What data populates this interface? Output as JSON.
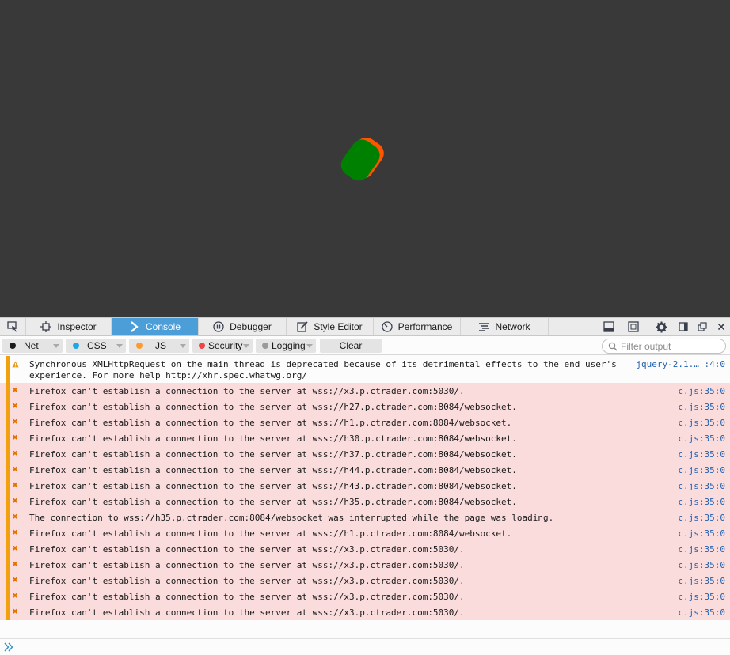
{
  "colors": {
    "page_bg": "#393939",
    "loader_front": "#008000",
    "loader_back": "#ff5500",
    "selected_tab": "#4c9ed9",
    "error_bg": "#fadcdc",
    "severity_bar": "#f1a10d",
    "location_link": "#1f60b0"
  },
  "toolbar": {
    "picker_icon": "element-picker-icon",
    "tabs": [
      {
        "label": "Inspector",
        "icon": "inspector-icon"
      },
      {
        "label": "Console",
        "icon": "console-icon"
      },
      {
        "label": "Debugger",
        "icon": "debugger-icon"
      },
      {
        "label": "Style Editor",
        "icon": "style-editor-icon"
      },
      {
        "label": "Performance",
        "icon": "performance-icon"
      },
      {
        "label": "Network",
        "icon": "network-icon"
      }
    ],
    "right_icons": [
      "split-console-icon",
      "responsive-mode-icon",
      "settings-icon",
      "dock-side-icon",
      "separate-window-icon",
      "close-icon"
    ]
  },
  "filters": {
    "buttons": [
      {
        "label": "Net",
        "dot_color": "#1a1a1a"
      },
      {
        "label": "CSS",
        "dot_color": "#1ea6e6"
      },
      {
        "label": "JS",
        "dot_color": "#ff9a2e"
      },
      {
        "label": "Security",
        "dot_color": "#ee4444"
      },
      {
        "label": "Logging",
        "dot_color": "#9a9a9a"
      }
    ],
    "clear_label": "Clear",
    "search_placeholder": "Filter output"
  },
  "messages": [
    {
      "type": "warning",
      "text": "Synchronous XMLHttpRequest on the main thread is deprecated because of its detrimental effects to the end user's\nexperience. For more help http://xhr.spec.whatwg.org/",
      "location": "jquery-2.1.… :4:0"
    },
    {
      "type": "error",
      "text": "Firefox can't establish a connection to the server at wss://x3.p.ctrader.com:5030/.",
      "location": "c.js:35:0"
    },
    {
      "type": "error",
      "text": "Firefox can't establish a connection to the server at wss://h27.p.ctrader.com:8084/websocket.",
      "location": "c.js:35:0"
    },
    {
      "type": "error",
      "text": "Firefox can't establish a connection to the server at wss://h1.p.ctrader.com:8084/websocket.",
      "location": "c.js:35:0"
    },
    {
      "type": "error",
      "text": "Firefox can't establish a connection to the server at wss://h30.p.ctrader.com:8084/websocket.",
      "location": "c.js:35:0"
    },
    {
      "type": "error",
      "text": "Firefox can't establish a connection to the server at wss://h37.p.ctrader.com:8084/websocket.",
      "location": "c.js:35:0"
    },
    {
      "type": "error",
      "text": "Firefox can't establish a connection to the server at wss://h44.p.ctrader.com:8084/websocket.",
      "location": "c.js:35:0"
    },
    {
      "type": "error",
      "text": "Firefox can't establish a connection to the server at wss://h43.p.ctrader.com:8084/websocket.",
      "location": "c.js:35:0"
    },
    {
      "type": "error",
      "text": "Firefox can't establish a connection to the server at wss://h35.p.ctrader.com:8084/websocket.",
      "location": "c.js:35:0"
    },
    {
      "type": "error",
      "text": "The connection to wss://h35.p.ctrader.com:8084/websocket was interrupted while the page was loading.",
      "location": "c.js:35:0"
    },
    {
      "type": "error",
      "text": "Firefox can't establish a connection to the server at wss://h1.p.ctrader.com:8084/websocket.",
      "location": "c.js:35:0"
    },
    {
      "type": "error",
      "text": "Firefox can't establish a connection to the server at wss://x3.p.ctrader.com:5030/.",
      "location": "c.js:35:0"
    },
    {
      "type": "error",
      "text": "Firefox can't establish a connection to the server at wss://x3.p.ctrader.com:5030/.",
      "location": "c.js:35:0"
    },
    {
      "type": "error",
      "text": "Firefox can't establish a connection to the server at wss://x3.p.ctrader.com:5030/.",
      "location": "c.js:35:0"
    },
    {
      "type": "error",
      "text": "Firefox can't establish a connection to the server at wss://x3.p.ctrader.com:5030/.",
      "location": "c.js:35:0"
    },
    {
      "type": "error",
      "text": "Firefox can't establish a connection to the server at wss://x3.p.ctrader.com:5030/.",
      "location": "c.js:35:0"
    }
  ],
  "input": {
    "prompt_icon": "chevron-double-right-icon",
    "value": ""
  }
}
